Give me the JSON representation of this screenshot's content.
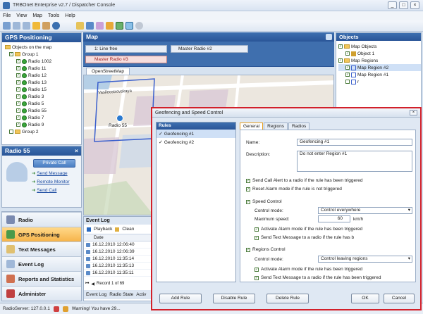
{
  "window": {
    "title": "TRBOnet Enterprise v2.7 / Dispatcher Console"
  },
  "menu": [
    "File",
    "View",
    "Map",
    "Tools",
    "Help"
  ],
  "gps": {
    "pane_title": "GPS Positioning",
    "root": "Objects on the map",
    "group1": "Group 1",
    "radios": [
      "Radio 1002",
      "Radio 11",
      "Radio 12",
      "Radio 13",
      "Radio 15",
      "Radio 3",
      "Radio 5",
      "Radio 55",
      "Radio 7",
      "Radio 9"
    ],
    "group2": "Group 2"
  },
  "radio55": {
    "title": "Radio 55",
    "private_call": "Private Call",
    "links": [
      "Send Message",
      "Remote Monitor",
      "Send Call"
    ]
  },
  "nav": [
    "Radio",
    "GPS Positioning",
    "Text Messages",
    "Event Log",
    "Reports and Statistics",
    "Administer"
  ],
  "map": {
    "title": "Map",
    "line_label": "1: Line free",
    "master2": "Master Radio #2",
    "master3": "Master Radio #3",
    "tab": "OpenStreetMap",
    "street": "Vasileostrovskaya",
    "radio_marker": "Radio 55"
  },
  "objects": {
    "title": "Objects",
    "map_objects": "Map Objects",
    "object1": "Object 1",
    "map_regions": "Map Regions",
    "region2": "Map Region #2",
    "region1": "Map Region #1",
    "r": "r"
  },
  "eventlog": {
    "title": "Event Log",
    "playback": "Playback",
    "clean": "Clean",
    "col_date": "Date",
    "rows": [
      "16.12.2010 12:06:40",
      "16.12.2010 12:06:39",
      "16.12.2010 11:35:14",
      "16.12.2010 11:35:13",
      "16.12.2010 11:35:11"
    ],
    "record": "Record 1 of 69",
    "tabs": [
      "Event Log",
      "Radio State",
      "Activ"
    ]
  },
  "status": {
    "server": "RadioServer: 127.0.0.1",
    "warning": "Warning! You have 29..."
  },
  "dialog": {
    "title": "Geofencing and Speed Control",
    "rules_title": "Rules",
    "rules": [
      "Geofencing #1",
      "Geofencing #2"
    ],
    "tabs": [
      "General",
      "Regions",
      "Radios"
    ],
    "name_label": "Name:",
    "name_value": "Geofencing #1",
    "desc_label": "Description:",
    "desc_value": "Do not enter Region #1",
    "send_call_alert": "Send Call Alert to a radio if the rule has been triggered",
    "reset_alarm": "Reset Alarm mode if the rule is not triggered",
    "speed_control": "Speed Control",
    "control_mode_label": "Control mode:",
    "speed_mode_value": "Control everywhere",
    "max_speed_label": "Maximum speed:",
    "max_speed_value": "60",
    "speed_unit": "km/h",
    "speed_activate_alarm": "Activate Alarm mode if the rule has been triggered",
    "speed_send_text": "Send Text Message to a radio if the rule has b",
    "regions_control": "Regions Control",
    "region_mode_value": "Control leaving regions",
    "reg_activate_alarm": "Activate Alarm mode if the rule has been triggered",
    "reg_send_text": "Send Text Message to a radio if the rule has been triggered",
    "buttons": {
      "add": "Add Rule",
      "disable": "Disable Rule",
      "delete": "Delete Rule",
      "ok": "OK",
      "cancel": "Cancel"
    }
  }
}
